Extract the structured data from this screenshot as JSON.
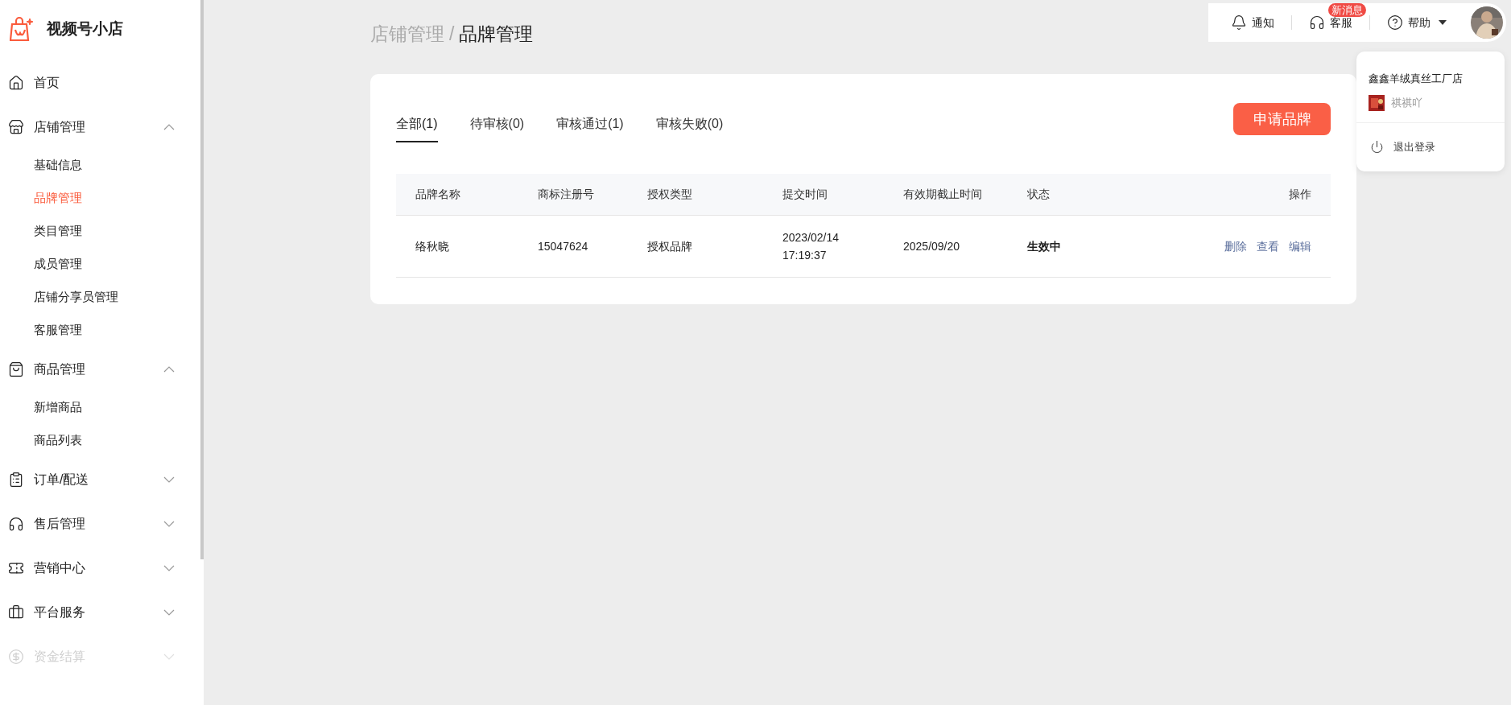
{
  "logo": {
    "title": "视频号小店"
  },
  "sidebar": {
    "items": [
      {
        "label": "首页",
        "kind": "link",
        "disabled": false
      },
      {
        "label": "店铺管理",
        "kind": "group",
        "expanded": true,
        "disabled": false,
        "children": [
          {
            "label": "基础信息",
            "selected": false
          },
          {
            "label": "品牌管理",
            "selected": true
          },
          {
            "label": "类目管理",
            "selected": false
          },
          {
            "label": "成员管理",
            "selected": false
          },
          {
            "label": "店铺分享员管理",
            "selected": false
          },
          {
            "label": "客服管理",
            "selected": false
          }
        ]
      },
      {
        "label": "商品管理",
        "kind": "group",
        "expanded": true,
        "disabled": false,
        "children": [
          {
            "label": "新增商品",
            "selected": false
          },
          {
            "label": "商品列表",
            "selected": false
          }
        ]
      },
      {
        "label": "订单/配送",
        "kind": "group",
        "expanded": false,
        "disabled": false
      },
      {
        "label": "售后管理",
        "kind": "group",
        "expanded": false,
        "disabled": false
      },
      {
        "label": "营销中心",
        "kind": "group",
        "expanded": false,
        "disabled": false
      },
      {
        "label": "平台服务",
        "kind": "group",
        "expanded": false,
        "disabled": false
      },
      {
        "label": "资金结算",
        "kind": "group",
        "expanded": false,
        "disabled": true
      }
    ]
  },
  "breadcrumb": [
    "店铺管理",
    "品牌管理"
  ],
  "breadcrumb_separator": "/",
  "topbar": {
    "items": [
      {
        "label": "通知"
      },
      {
        "label": "客服",
        "badge": "新消息"
      },
      {
        "label": "帮助"
      }
    ]
  },
  "account_menu": {
    "shop_name": "鑫鑫羊绒真丝工厂店",
    "account_name": "祺祺吖",
    "logout": "退出登录"
  },
  "tabs": [
    {
      "label": "全部(1)",
      "selected": true
    },
    {
      "label": "待审核(0)",
      "selected": false
    },
    {
      "label": "审核通过(1)",
      "selected": false
    },
    {
      "label": "审核失败(0)",
      "selected": false
    }
  ],
  "apply_button": "申请品牌",
  "table": {
    "columns": [
      "品牌名称",
      "商标注册号",
      "授权类型",
      "提交时间",
      "有效期截止时间",
      "状态",
      "操作"
    ],
    "rows": [
      {
        "cells": [
          "络秋晓",
          "15047624",
          "授权品牌",
          [
            "2023/02/14",
            "17:19:37"
          ],
          "2025/09/20",
          "生效中"
        ],
        "actions": [
          "删除",
          "查看",
          "编辑"
        ]
      }
    ]
  }
}
